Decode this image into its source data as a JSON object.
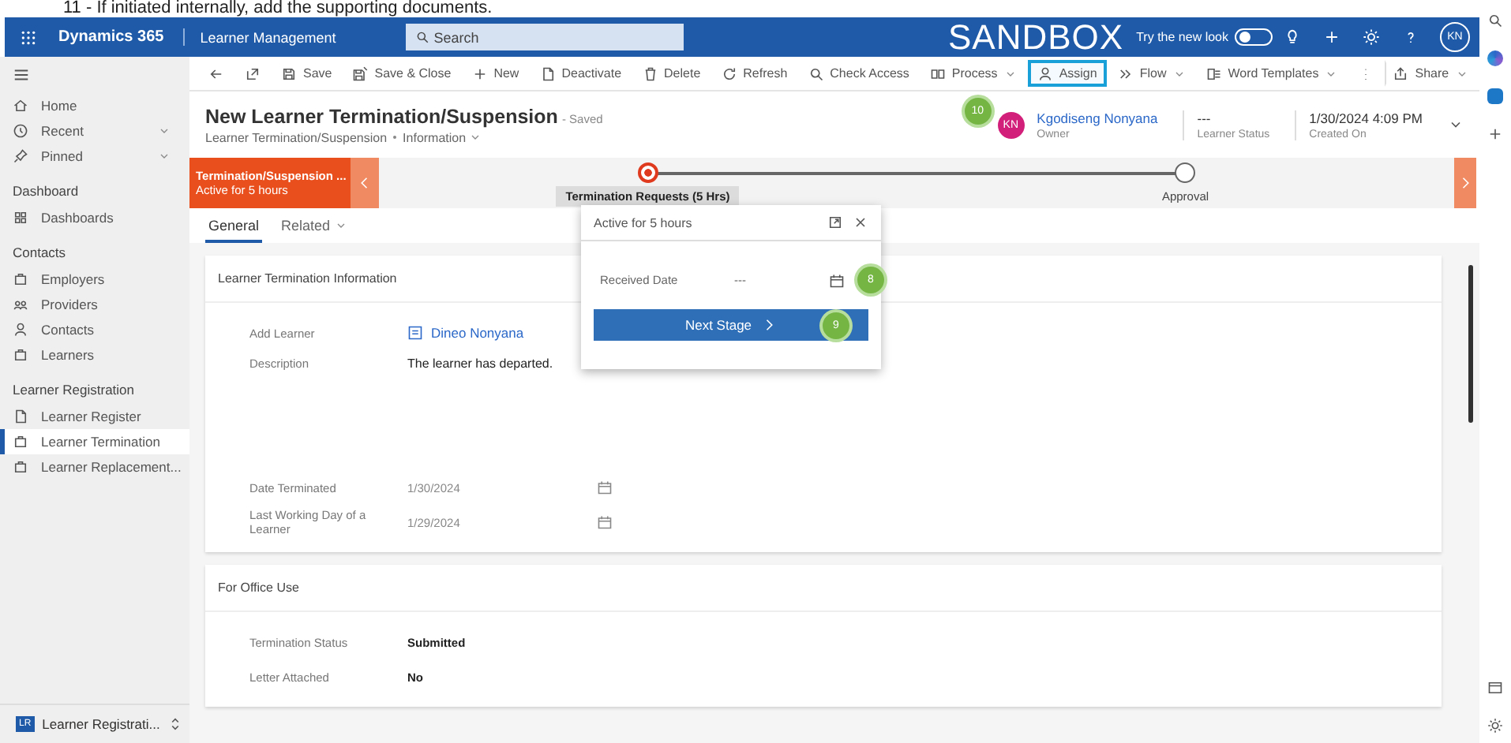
{
  "caption": "11 - If initiated internally, add the supporting documents.",
  "top_bar": {
    "app_name": "Dynamics 365",
    "area": "Learner Management",
    "search": {
      "placeholder": "Search"
    },
    "environment": "SANDBOX",
    "new_look": {
      "label": "Try the new look",
      "on": false
    },
    "user_initials": "KN"
  },
  "command_bar": [
    {
      "kind": "back",
      "highlighted": false,
      "dropdown": false
    },
    {
      "kind": "popout",
      "highlighted": false,
      "dropdown": false
    },
    {
      "kind": "save",
      "label": "Save",
      "highlighted": false,
      "dropdown": false
    },
    {
      "kind": "saveclose",
      "label": "Save & Close",
      "highlighted": false,
      "dropdown": false
    },
    {
      "kind": "plus",
      "label": "New",
      "highlighted": false,
      "dropdown": false
    },
    {
      "kind": "page",
      "label": "Deactivate",
      "highlighted": false,
      "dropdown": false
    },
    {
      "kind": "delete",
      "label": "Delete",
      "highlighted": false,
      "dropdown": false
    },
    {
      "kind": "refresh",
      "label": "Refresh",
      "highlighted": false,
      "dropdown": false
    },
    {
      "kind": "search",
      "label": "Check Access",
      "highlighted": false,
      "dropdown": false
    },
    {
      "kind": "process",
      "label": "Process",
      "highlighted": false,
      "dropdown": true
    },
    {
      "kind": "person",
      "label": "Assign",
      "highlighted": true,
      "dropdown": false
    },
    {
      "kind": "flow",
      "label": "Flow",
      "highlighted": false,
      "dropdown": true
    },
    {
      "kind": "document",
      "label": "Word Templates",
      "highlighted": false,
      "dropdown": true
    },
    {
      "kind": "more",
      "highlighted": false,
      "dropdown": false
    },
    {
      "kind": "share",
      "label": "Share",
      "highlighted": false,
      "dropdown": true
    }
  ],
  "sidebar": {
    "top": [
      {
        "kind": "home",
        "label": "Home",
        "expandable": false
      },
      {
        "kind": "clock",
        "label": "Recent",
        "expandable": true
      },
      {
        "kind": "pin",
        "label": "Pinned",
        "expandable": true
      }
    ],
    "groups": [
      {
        "title": "Dashboard",
        "items": [
          {
            "kind": "grid",
            "label": "Dashboards",
            "selected": false
          }
        ]
      },
      {
        "title": "Contacts",
        "items": [
          {
            "kind": "entity",
            "label": "Employers",
            "selected": false
          },
          {
            "kind": "people",
            "label": "Providers",
            "selected": false
          },
          {
            "kind": "person",
            "label": "Contacts",
            "selected": false
          },
          {
            "kind": "entity",
            "label": "Learners",
            "selected": false
          }
        ]
      },
      {
        "title": "Learner Registration",
        "items": [
          {
            "kind": "page",
            "label": "Learner Register",
            "selected": false
          },
          {
            "kind": "entity",
            "label": "Learner Termination",
            "selected": true
          },
          {
            "kind": "entity",
            "label": "Learner Replacement...",
            "selected": false
          }
        ]
      }
    ],
    "area_switcher": {
      "initials": "LR",
      "label": "Learner Registrati..."
    }
  },
  "record": {
    "title": "New Learner Termination/Suspension",
    "status": "- Saved",
    "entity": "Learner Termination/Suspension",
    "form": "Information",
    "owner": {
      "initials": "KN",
      "name": "Kgodiseng Nonyana",
      "role": "Owner",
      "annotation": "10"
    },
    "header_fields": [
      {
        "value": "---",
        "label": "Learner Status"
      },
      {
        "value": "1/30/2024 4:09 PM",
        "label": "Created On"
      }
    ]
  },
  "process": {
    "active_stage": {
      "name": "Termination/Suspension ...",
      "duration": "Active for 5 hours"
    },
    "stages": [
      {
        "name": "Termination Requests (5 Hrs)",
        "selected": true
      },
      {
        "name": "Approval",
        "selected": false
      }
    ]
  },
  "flyout": {
    "title": "Active for 5 hours",
    "fields": [
      {
        "label": "Received Date",
        "value": "---",
        "annotation": "8"
      }
    ],
    "button": {
      "label": "Next Stage",
      "annotation": "9"
    }
  },
  "tabs": [
    {
      "label": "General",
      "selected": true,
      "dropdown": false
    },
    {
      "label": "Related",
      "selected": false,
      "dropdown": true
    }
  ],
  "sections": [
    {
      "title": "Learner Termination Information",
      "fields": [
        {
          "label": "Add Learner",
          "value": "Dineo Nonyana",
          "kind": "lookup"
        },
        {
          "label": "Description",
          "value": "The learner has departed.",
          "kind": "multiline"
        },
        {
          "label": "Date Terminated",
          "value": "1/30/2024",
          "kind": "date"
        },
        {
          "label": "Last Working Day of a Learner",
          "value": "1/29/2024",
          "kind": "date"
        }
      ]
    },
    {
      "title": "For Office Use",
      "fields": [
        {
          "label": "Termination Status",
          "value": "Submitted",
          "kind": "text"
        },
        {
          "label": "Letter Attached",
          "value": "No",
          "kind": "text"
        }
      ]
    }
  ]
}
